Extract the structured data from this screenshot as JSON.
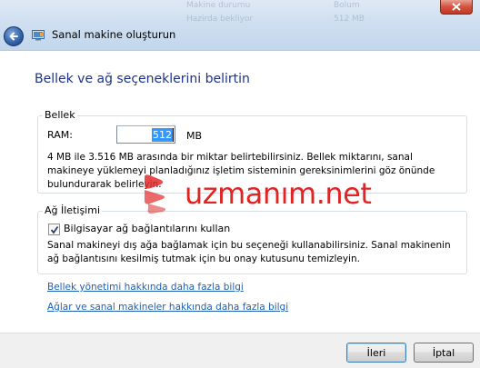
{
  "window": {
    "title": "Sanal makine oluşturun",
    "background_rows": [
      {
        "col1": "Makine durumu",
        "col2": "Bolum"
      },
      {
        "col1": "Hazirda bekliyor",
        "col2": "512 MB"
      }
    ]
  },
  "page": {
    "heading": "Bellek ve ağ seçeneklerini belirtin"
  },
  "memory": {
    "group_label": "Bellek",
    "ram_label": "RAM:",
    "ram_value": "512",
    "unit": "MB",
    "description": "4 MB ile 3.516 MB arasında bir miktar belirtebilirsiniz. Bellek miktarını, sanal makineye yüklemeyi planladığınız işletim sisteminin gereksinimlerini göz önünde bulundurarak belirleyin."
  },
  "network": {
    "group_label": "Ağ İletişimi",
    "checkbox_label": "Bilgisayar ağ bağlantılarını kullan",
    "checkbox_checked": true,
    "description": "Sanal makineyi dış ağa bağlamak için bu seçeneği kullanabilirsiniz. Sanal makinenin ağ bağlantısını kesilmiş tutmak için bu onay kutusunu temizleyin."
  },
  "links": {
    "memory_link": "Bellek yönetimi hakkında daha fazla bilgi",
    "network_link": "Ağlar ve sanal makineler hakkında daha fazla bilgi"
  },
  "buttons": {
    "next": "İleri",
    "cancel": "İptal"
  },
  "watermark": {
    "text": "uzmanım.net"
  },
  "colors": {
    "heading": "#1e3287",
    "link": "#1c5fb7",
    "watermark": "#e02424",
    "selection": "#3399ff"
  },
  "icons": [
    "back-arrow-icon",
    "virtual-machine-icon",
    "close-icon",
    "checkmark-icon"
  ]
}
